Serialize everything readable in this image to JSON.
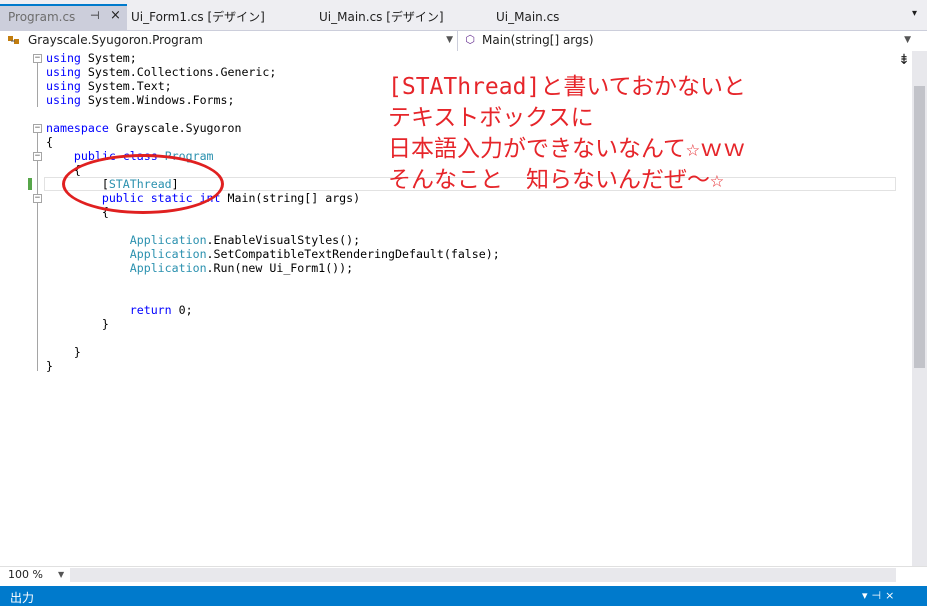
{
  "tabs": [
    {
      "label": "Program.cs",
      "active": true
    },
    {
      "label": "Ui_Form1.cs [デザイン]"
    },
    {
      "label": "Ui_Main.cs [デザイン]"
    },
    {
      "label": "Ui_Main.cs"
    }
  ],
  "tab_pin": "⊣",
  "tab_close": "×",
  "navbar": {
    "class_combo": "Grayscale.Syugoron.Program",
    "member_combo": "Main(string[] args)"
  },
  "code_lines": [
    "using System;",
    "using System.Collections.Generic;",
    "using System.Text;",
    "using System.Windows.Forms;",
    "",
    "namespace Grayscale.Syugoron",
    "{",
    "    public class Program",
    "    {",
    "        [STAThread]",
    "        public static int Main(string[] args)",
    "        {",
    "",
    "            Application.EnableVisualStyles();",
    "            Application.SetCompatibleTextRenderingDefault(false);",
    "            Application.Run(new Ui_Form1());",
    "",
    "",
    "            return 0;",
    "        }",
    "",
    "    }",
    "}"
  ],
  "annotation": [
    "[STAThread]と書いておかないと",
    "テキストボックスに",
    "日本語入力ができないなんて☆ｗｗ",
    "そんなこと　知らないんだぜ～☆"
  ],
  "zoom": "100 %",
  "output_panel_title": "出力",
  "colors": {
    "accent": "#007acc",
    "keyword": "#0000ff",
    "type": "#2b91af",
    "annotation": "#e6252a"
  }
}
